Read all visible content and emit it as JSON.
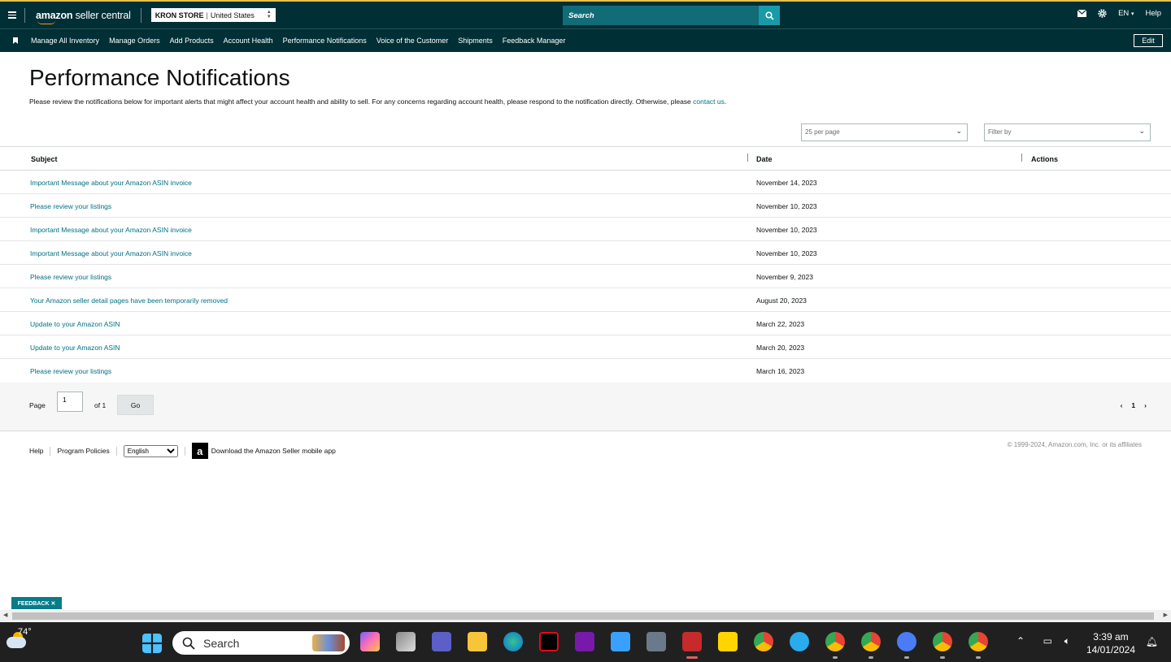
{
  "header": {
    "logo_text_bold": "amazon",
    "logo_text_rest": " seller central",
    "store_name": "KRON STORE",
    "store_region": "United States",
    "search_placeholder": "Search",
    "language": "EN",
    "help": "Help"
  },
  "nav": {
    "items": [
      "Manage All Inventory",
      "Manage Orders",
      "Add Products",
      "Account Health",
      "Performance Notifications",
      "Voice of the Customer",
      "Shipments",
      "Feedback Manager"
    ],
    "edit_label": "Edit"
  },
  "page": {
    "title": "Performance Notifications",
    "intro": "Please review the notifications below for important alerts that might affect your account health and ability to sell. For any concerns regarding account health, please respond to the notification directly. Otherwise, please ",
    "intro_link": "contact us",
    "intro_end": "."
  },
  "filters": {
    "per_page": "25 per page",
    "filter_by": "Filter by"
  },
  "table": {
    "headers": {
      "subject": "Subject",
      "date": "Date",
      "actions": "Actions"
    },
    "rows": [
      {
        "subject": "Important Message about your Amazon ASIN invoice",
        "date": "November 14, 2023"
      },
      {
        "subject": "Please review your listings",
        "date": "November 10, 2023"
      },
      {
        "subject": "Important Message about your Amazon ASIN invoice",
        "date": "November 10, 2023"
      },
      {
        "subject": "Important Message about your Amazon ASIN invoice",
        "date": "November 10, 2023"
      },
      {
        "subject": "Please review your listings",
        "date": "November 9, 2023"
      },
      {
        "subject": "Your Amazon seller detail pages have been temporarily removed",
        "date": "August 20, 2023"
      },
      {
        "subject": "Update to your Amazon ASIN",
        "date": "March 22, 2023"
      },
      {
        "subject": "Update to your Amazon ASIN",
        "date": "March 20, 2023"
      },
      {
        "subject": "Please review your listings",
        "date": "March 16, 2023"
      }
    ]
  },
  "pager": {
    "page_label": "Page",
    "page_value": "1",
    "of_label": "of 1",
    "go_label": "Go",
    "prev": "‹",
    "current": "1",
    "next": "›"
  },
  "footer": {
    "help": "Help",
    "program_policies": "Program Policies",
    "language_selected": "English",
    "app_link": "Download the Amazon Seller mobile app",
    "copyright": "© 1999-2024, Amazon.com, Inc. or its affiliates"
  },
  "feedback_label": "FEEDBACK ✕",
  "taskbar": {
    "temperature": "74°",
    "search_label": "Search",
    "time": "3:39 am",
    "date": "14/01/2024"
  }
}
